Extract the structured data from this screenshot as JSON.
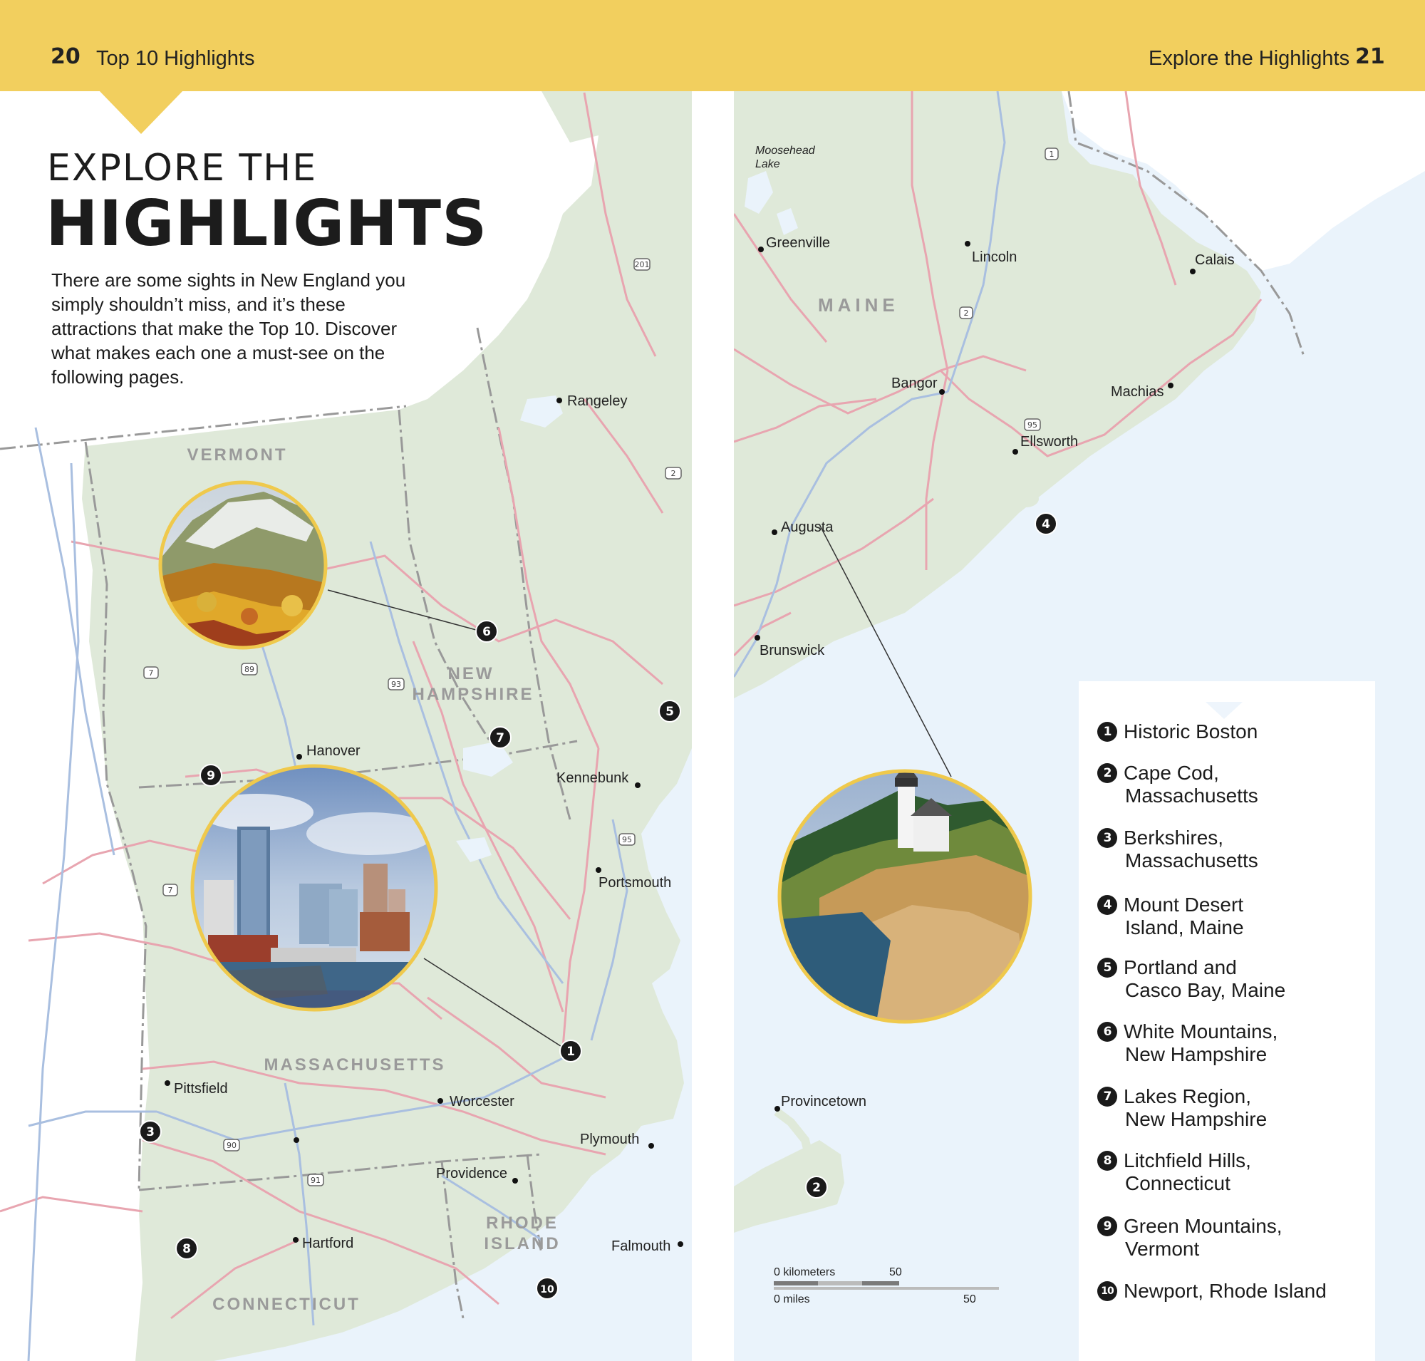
{
  "header": {
    "left_page_number": "20",
    "left_label": "Top 10 Highlights",
    "right_label": "Explore the Highlights",
    "right_page_number": "21"
  },
  "title": {
    "line1": "EXPLORE THE",
    "line2": "HIGHLIGHTS"
  },
  "intro": "There are some sights in New England you simply shouldn’t miss, and it’s these attractions that make the Top 10. Discover what makes each one a must-see on the following pages.",
  "map": {
    "states": [
      "VERMONT",
      "NEW",
      "HAMPSHIRE",
      "MASSACHUSETTS",
      "RHODE",
      "ISLAND",
      "CONNECTICUT",
      "MAINE"
    ],
    "places": [
      "Rangeley",
      "Hanover",
      "Kennebunk",
      "Portsmouth",
      "Pittsfield",
      "Worcester",
      "Plymouth",
      "Providence",
      "Hartford",
      "Falmouth",
      "Moosehead",
      "Lake",
      "Greenville",
      "Lincoln",
      "Calais",
      "Bangor",
      "Machias",
      "Ellsworth",
      "Augusta",
      "Brunswick",
      "Provincetown"
    ],
    "routes": [
      "201",
      "2",
      "7",
      "89",
      "93",
      "95",
      "7",
      "90",
      "91",
      "1",
      "2",
      "95"
    ],
    "markers": [
      "1",
      "2",
      "3",
      "4",
      "5",
      "6",
      "7",
      "8",
      "9",
      "10"
    ],
    "scale": {
      "km_label": "0 kilometers",
      "km_value": "50",
      "mi_label": "0 miles",
      "mi_value": "50"
    },
    "colors": {
      "land": "#dfe9d9",
      "water": "#eaf3fb",
      "road_red": "#e8a5b0",
      "road_blue": "#a9bfe0",
      "border": "#8f8f8f",
      "photo_ring": "#efc94c"
    },
    "photos": [
      "mountain-foliage-photo",
      "boston-skyline-photo",
      "lighthouse-coast-photo"
    ]
  },
  "legend": {
    "items": [
      {
        "num": "1",
        "line1": "Historic Boston",
        "line2": ""
      },
      {
        "num": "2",
        "line1": "Cape Cod,",
        "line2": "Massachusetts"
      },
      {
        "num": "3",
        "line1": "Berkshires,",
        "line2": "Massachusetts"
      },
      {
        "num": "4",
        "line1": "Mount Desert",
        "line2": "Island, Maine"
      },
      {
        "num": "5",
        "line1": "Portland and",
        "line2": "Casco Bay, Maine"
      },
      {
        "num": "6",
        "line1": "White Mountains,",
        "line2": "New Hampshire"
      },
      {
        "num": "7",
        "line1": "Lakes Region,",
        "line2": "New Hampshire"
      },
      {
        "num": "8",
        "line1": "Litchfield Hills,",
        "line2": "Connecticut"
      },
      {
        "num": "9",
        "line1": "Green Mountains,",
        "line2": "Vermont"
      },
      {
        "num": "10",
        "line1": "Newport, Rhode Island",
        "line2": ""
      }
    ]
  }
}
